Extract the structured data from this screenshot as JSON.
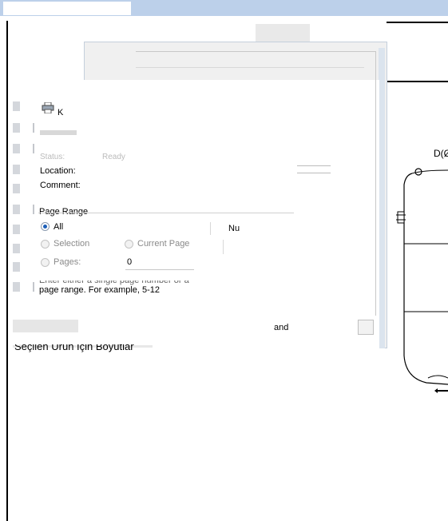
{
  "dialog": {
    "printer_name_fragment": "K",
    "status_label_fragment": "Status:",
    "status_value_fragment": "Ready",
    "location_label": "Location:",
    "comment_label": "Comment:",
    "page_range": {
      "legend": "Page Range",
      "all_label": "All",
      "selection_label": "Selection",
      "current_page_label": "Current Page",
      "pages_label": "Pages:",
      "pages_value": "0",
      "hint_line1": "Enter either a single page number or a",
      "hint_line2": "page range.  For example, 5-12"
    },
    "copies_label_fragment": "Nu",
    "and_fragment": "and"
  },
  "document": {
    "caption": "Seçilen Ürün İçin Boyutlar",
    "dimension_label": "D(Ø"
  },
  "icons": {
    "printer": "printer-icon"
  }
}
